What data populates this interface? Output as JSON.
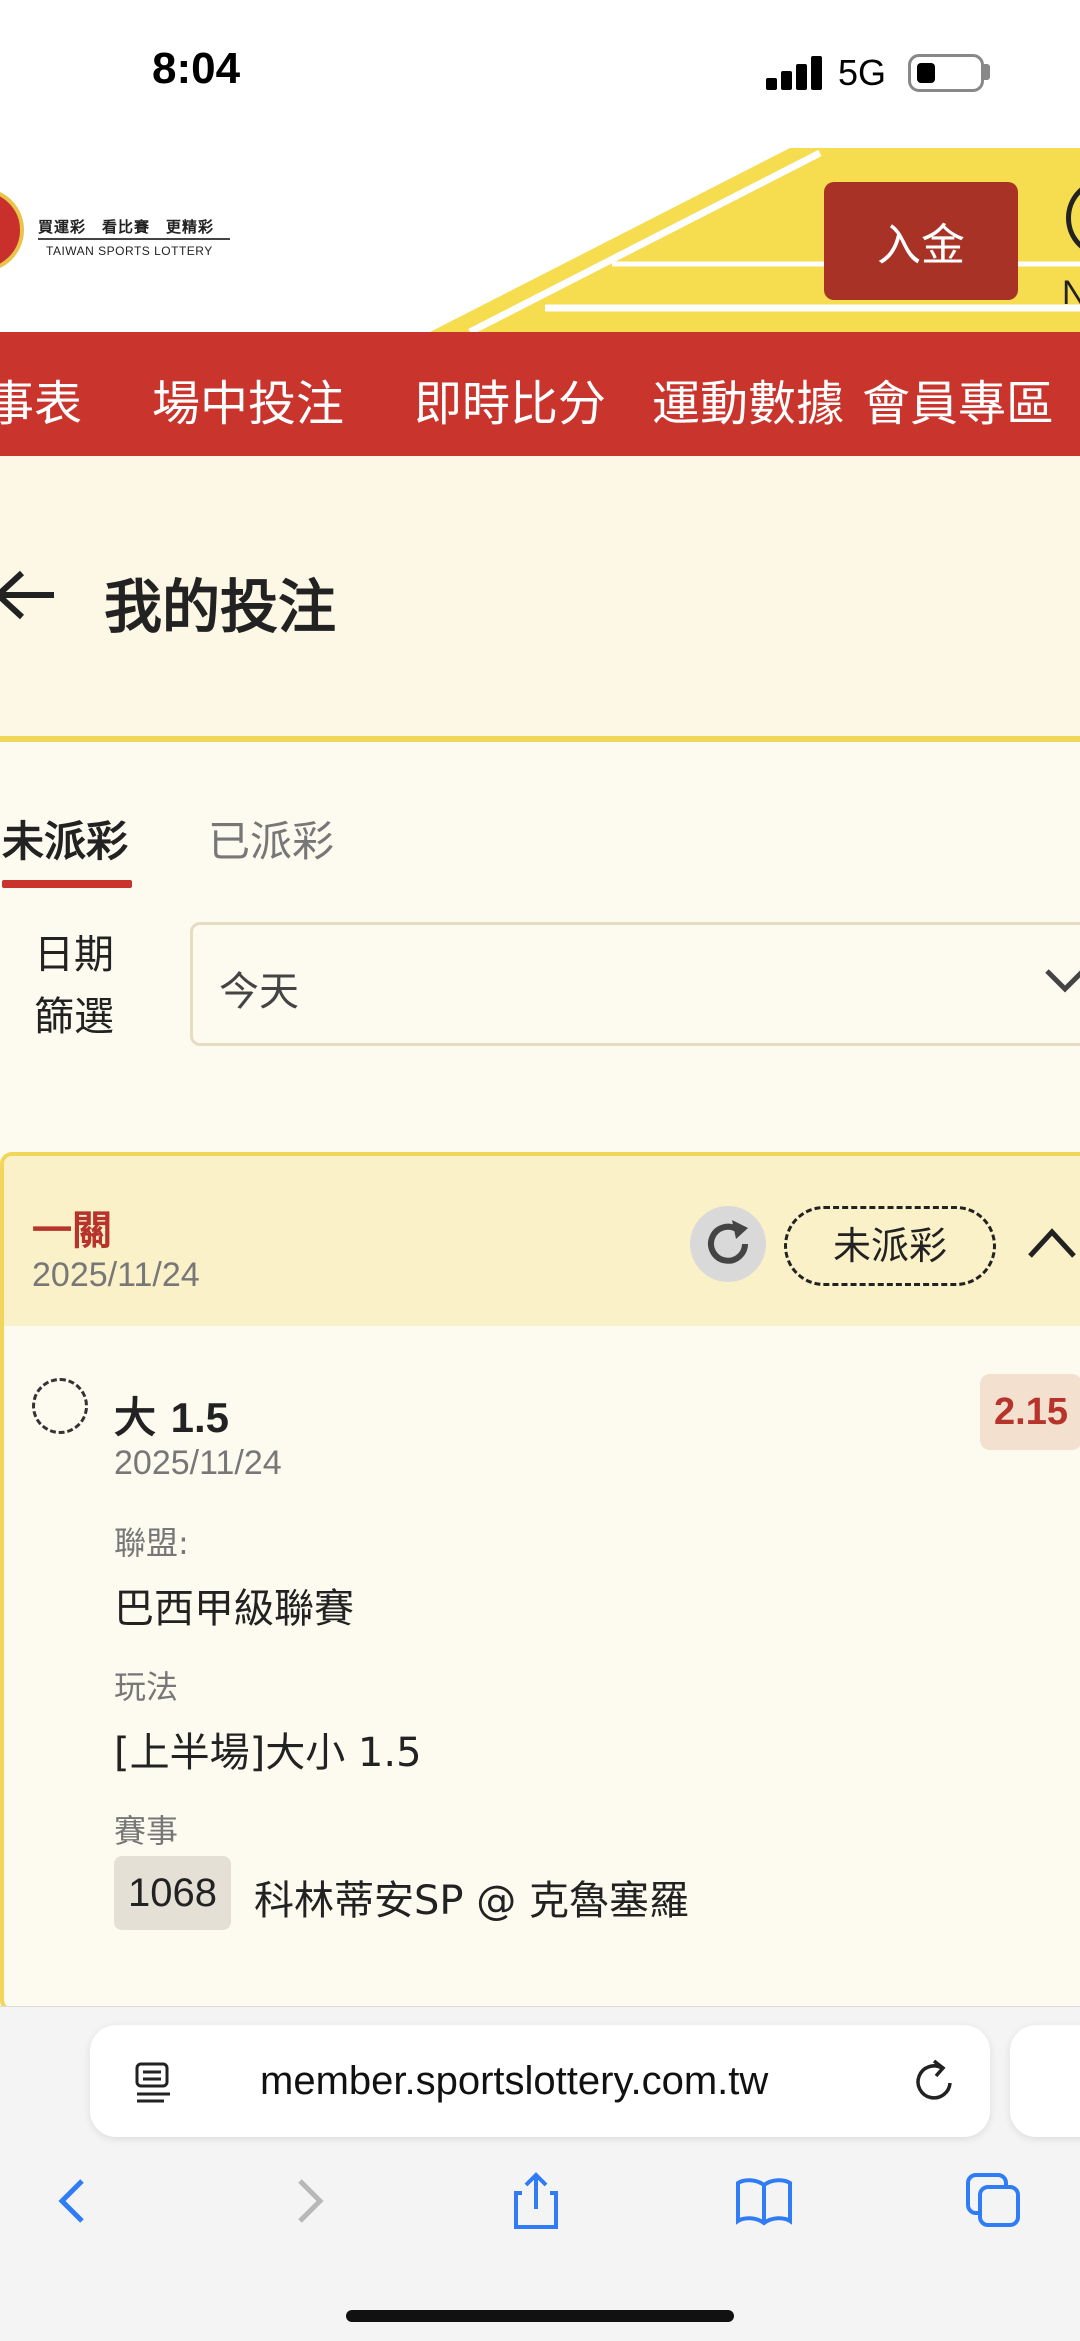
{
  "status_bar": {
    "time": "8:04",
    "network": "5G"
  },
  "header": {
    "logo_slogan": "買運彩　看比賽　更精彩",
    "logo_english": "TAIWAN SPORTS LOTTERY",
    "deposit_label": "入金",
    "account_letter": "N",
    "colors": {
      "brand_red": "#c9342d",
      "accent_yellow": "#f6dc4f",
      "button_red": "#a83226"
    }
  },
  "nav": {
    "items": [
      "事表",
      "場中投注",
      "即時比分",
      "運動數據",
      "會員專區"
    ]
  },
  "page": {
    "title": "我的投注"
  },
  "tabs": {
    "active": "未派彩",
    "inactive": "已派彩"
  },
  "filter": {
    "label_line1": "日期",
    "label_line2": "篩選",
    "selected": "今天"
  },
  "bet": {
    "type": "一關",
    "date": "2025/11/24",
    "status": "未派彩",
    "selection_prefix": "大",
    "selection_value": "1.5",
    "odds": "2.15",
    "selection_date": "2025/11/24",
    "league_label": "聯盟:",
    "league": "巴西甲級聯賽",
    "market_label": "玩法",
    "market": "[上半場]大小 1.5",
    "event_label": "賽事",
    "event_id": "1068",
    "event_name": "科林蒂安SP @ 克魯塞羅"
  },
  "browser": {
    "url": "member.sportslottery.com.tw"
  }
}
